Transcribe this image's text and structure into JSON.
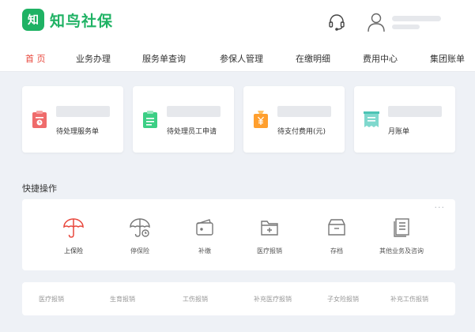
{
  "app": {
    "logo_mark": "知",
    "logo_text": "知鸟社保"
  },
  "header": {
    "support_icon": "headset-icon",
    "avatar_icon": "user-icon"
  },
  "nav": {
    "items": [
      "首 页",
      "业务办理",
      "服务单查询",
      "参保人管理",
      "在缴明细",
      "费用中心",
      "集团账单"
    ],
    "active_index": 0
  },
  "cards": [
    {
      "label": "待处理服务单",
      "icon": "clipboard-clock-icon"
    },
    {
      "label": "待处理员工申请",
      "icon": "clipboard-list-icon"
    },
    {
      "label": "待支付费用(元)",
      "icon": "yuan-bag-icon"
    },
    {
      "label": "月账单",
      "icon": "receipt-icon"
    }
  ],
  "quick_actions": {
    "title": "快捷操作",
    "more": "···",
    "items": [
      {
        "label": "上保险",
        "icon": "umbrella-icon"
      },
      {
        "label": "停保险",
        "icon": "umbrella-stop-icon"
      },
      {
        "label": "补缴",
        "icon": "wallet-icon"
      },
      {
        "label": "医疗报销",
        "icon": "medical-folder-icon"
      },
      {
        "label": "存档",
        "icon": "archive-box-icon"
      },
      {
        "label": "其他业务及咨询",
        "icon": "document-icon"
      }
    ]
  },
  "links": [
    "医疗报销",
    "生育报销",
    "工伤报销",
    "补充医疗报销",
    "子女险报销",
    "补充工伤报销"
  ],
  "colors": {
    "brand": "#1fb264",
    "active_nav": "#e8473c",
    "background": "#eef1f6"
  }
}
